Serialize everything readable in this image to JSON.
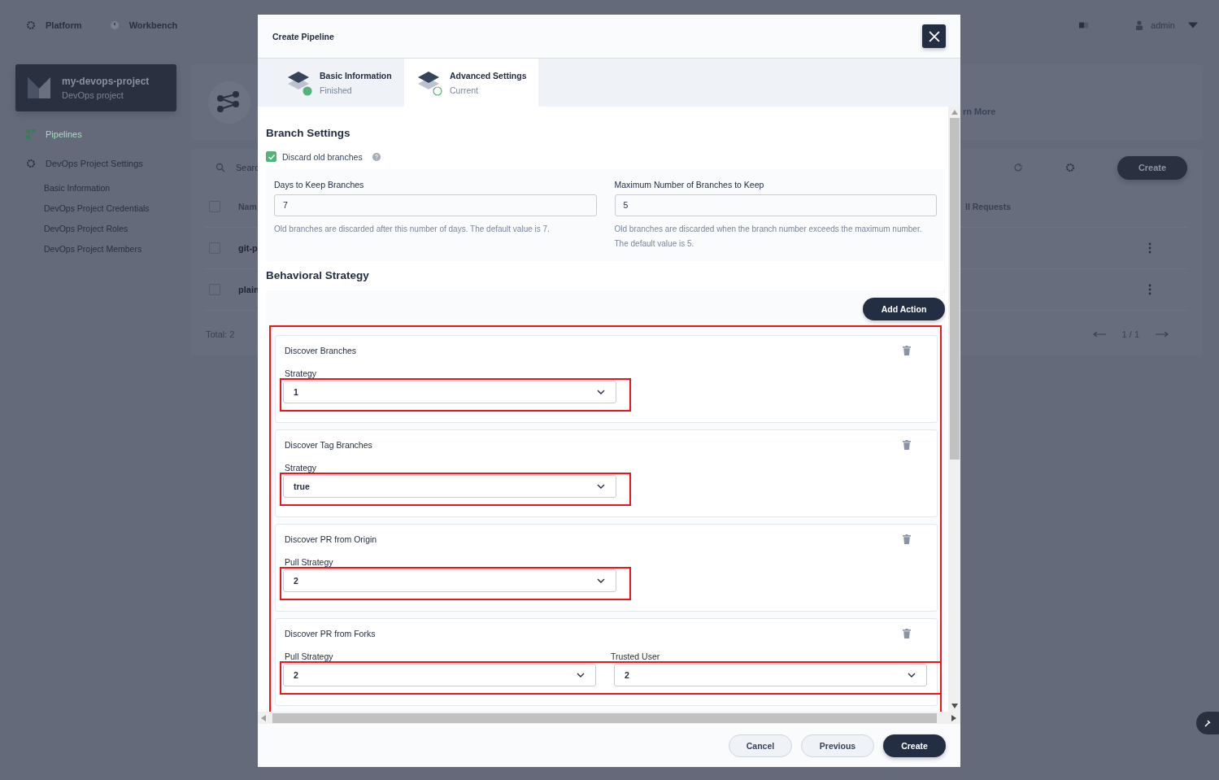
{
  "topbar": {
    "nav": [
      {
        "label": "Platform",
        "kind": "gear"
      },
      {
        "label": "Workbench",
        "kind": "clock"
      }
    ],
    "user": "admin"
  },
  "project": {
    "name": "my-devops-project",
    "type": "DevOps project"
  },
  "sidebar": {
    "items": [
      {
        "label": "Pipelines",
        "kind": "grid",
        "selected": true
      },
      {
        "label": "DevOps Project Settings",
        "kind": "gear",
        "selected": false,
        "children": [
          {
            "label": "Basic Information"
          },
          {
            "label": "DevOps Project Credentials"
          },
          {
            "label": "DevOps Project Roles"
          },
          {
            "label": "DevOps Project Members"
          }
        ]
      }
    ]
  },
  "banner": {
    "link": "rn More"
  },
  "list": {
    "search_placeholder": "Searc",
    "header_checked": false,
    "columns": [
      "Nam",
      "ll Requests"
    ],
    "rows": [
      {
        "name": "git-p",
        "checked": false
      },
      {
        "name": "plain",
        "checked": false
      }
    ],
    "create_button": "Create",
    "total": "Total: 2",
    "pagination": "1 / 1"
  },
  "dialog": {
    "title": "Create Pipeline",
    "steps": [
      {
        "title": "Basic Information",
        "status": "Finished",
        "finished": true,
        "selected": false
      },
      {
        "title": "Advanced Settings",
        "status": "Current",
        "finished": false,
        "selected": true
      }
    ],
    "branch_settings": {
      "heading": "Branch Settings",
      "discard": {
        "label": "Discard old branches",
        "checked": true
      },
      "fields": [
        {
          "label": "Days to Keep Branches",
          "value": "7",
          "hint": "Old branches are discarded after this number of days. The default value is 7."
        },
        {
          "label": "Maximum Number of Branches to Keep",
          "value": "5",
          "hint": "Old branches are discarded when the branch number exceeds the maximum number. The default value is 5."
        }
      ]
    },
    "behavioral": {
      "heading": "Behavioral Strategy",
      "add_button": "Add Action",
      "highlighted": true,
      "actions": [
        {
          "title": "Discover Branches",
          "highlighted": true,
          "fields": [
            {
              "label": "Strategy",
              "value": "1"
            }
          ]
        },
        {
          "title": "Discover Tag Branches",
          "highlighted": true,
          "fields": [
            {
              "label": "Strategy",
              "value": "true"
            }
          ]
        },
        {
          "title": "Discover PR from Origin",
          "highlighted": true,
          "fields": [
            {
              "label": "Pull Strategy",
              "value": "2"
            }
          ]
        },
        {
          "title": "Discover PR from Forks",
          "highlighted": true,
          "fields": [
            {
              "label": "Pull Strategy",
              "value": "2"
            },
            {
              "label": "Trusted User",
              "value": "2"
            }
          ]
        }
      ]
    },
    "buttons": [
      {
        "label": "Cancel",
        "kind": "secondary"
      },
      {
        "label": "Previous",
        "kind": "secondary"
      },
      {
        "label": "Create",
        "kind": "primary"
      }
    ]
  }
}
